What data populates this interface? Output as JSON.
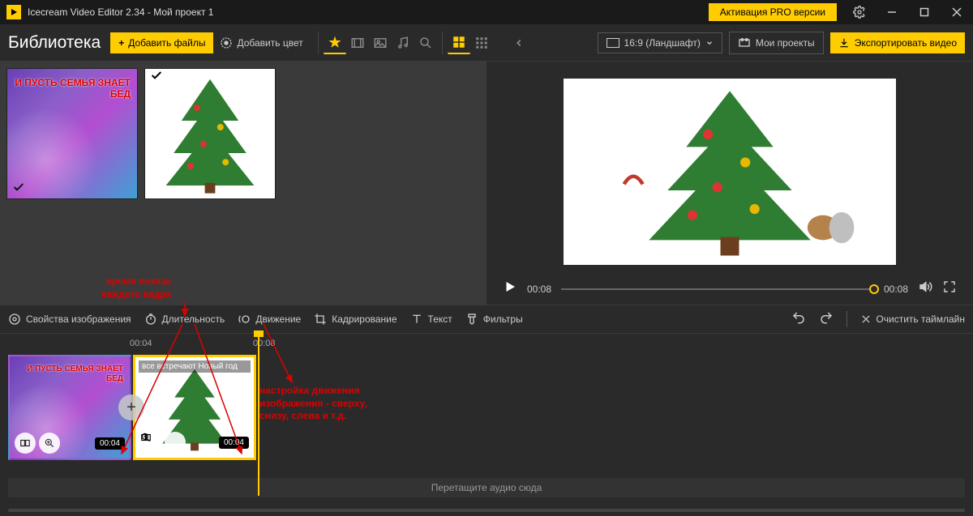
{
  "titlebar": {
    "app_name": "Icecream Video Editor 2.34",
    "project_sep": " - ",
    "project": "Мой проект 1",
    "pro_button": "Активация PRO версии"
  },
  "toolbar": {
    "library": "Библиотека",
    "add_files": "Добавить файлы",
    "add_color": "Добавить цвет",
    "ratio": "16:9 (Ландшафт)",
    "my_projects": "Мои проекты",
    "export": "Экспортировать видео"
  },
  "library_items": [
    {
      "overlay_text": "И ПУСТЬ СЕМЬЯ\nЗНАЕТ БЕД"
    },
    {
      "overlay_text": ""
    }
  ],
  "preview": {
    "time_current": "00:08",
    "time_total": "00:08"
  },
  "cliptools": {
    "image_props": "Свойства изображения",
    "duration": "Длительность",
    "motion": "Движение",
    "crop": "Кадрирование",
    "text": "Текст",
    "filters": "Фильтры",
    "clear": "Очистить таймлайн"
  },
  "timeline": {
    "ticks": [
      "00:04",
      "00:08"
    ],
    "clips": [
      {
        "caption": "",
        "duration": "00:04",
        "selected": false
      },
      {
        "caption": "все встречают Новый год",
        "duration": "00:04",
        "selected": true
      }
    ],
    "audio_placeholder": "Перетащите аудио сюда"
  },
  "annotations": {
    "a1": "время показа\nкаждого кадра",
    "a2": "настройка движения\nизображения - сверху,\nснизу, слева и т.д."
  }
}
